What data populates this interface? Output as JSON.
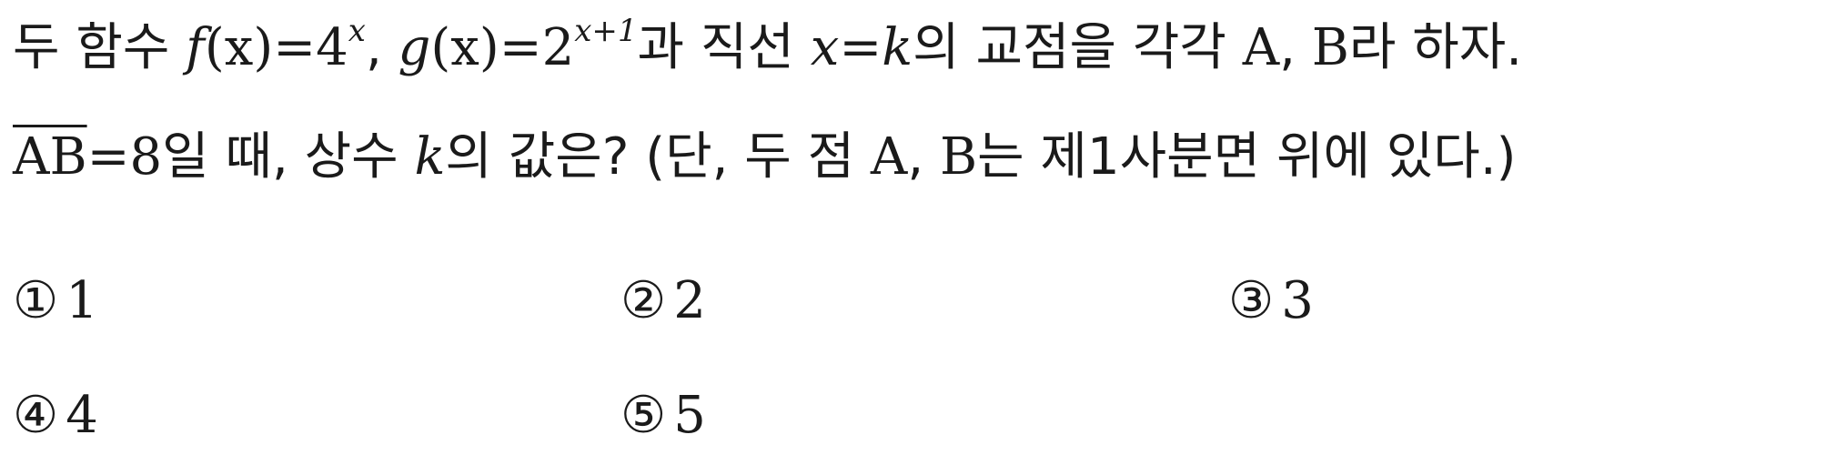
{
  "question": {
    "line1": {
      "t1": "두 함수 ",
      "f": "f",
      "fx": "(x)",
      "eq1": "=4",
      "exp1": "x",
      "comma": ", ",
      "g": "g",
      "gx": "(x)",
      "eq2": "=2",
      "exp2": "x+1",
      "t2": "과 직선 ",
      "x": "x",
      "eq3": "=",
      "k": "k",
      "t3": "의 교점을 각각 ",
      "A": "A",
      "t4": ", ",
      "B": "B",
      "t5": "라 하자."
    },
    "line2": {
      "AB": "AB",
      "eq": "=8",
      "t1": "일 때, 상수 ",
      "k": "k",
      "t2": "의 값은? (단, 두 점 ",
      "A": "A",
      "t3": ", ",
      "B": "B",
      "t4": "는 제1사분면 위에 있다.)"
    }
  },
  "choices": [
    {
      "mark": "①",
      "value": "1"
    },
    {
      "mark": "②",
      "value": "2"
    },
    {
      "mark": "③",
      "value": "3"
    },
    {
      "mark": "④",
      "value": "4"
    },
    {
      "mark": "⑤",
      "value": "5"
    }
  ]
}
